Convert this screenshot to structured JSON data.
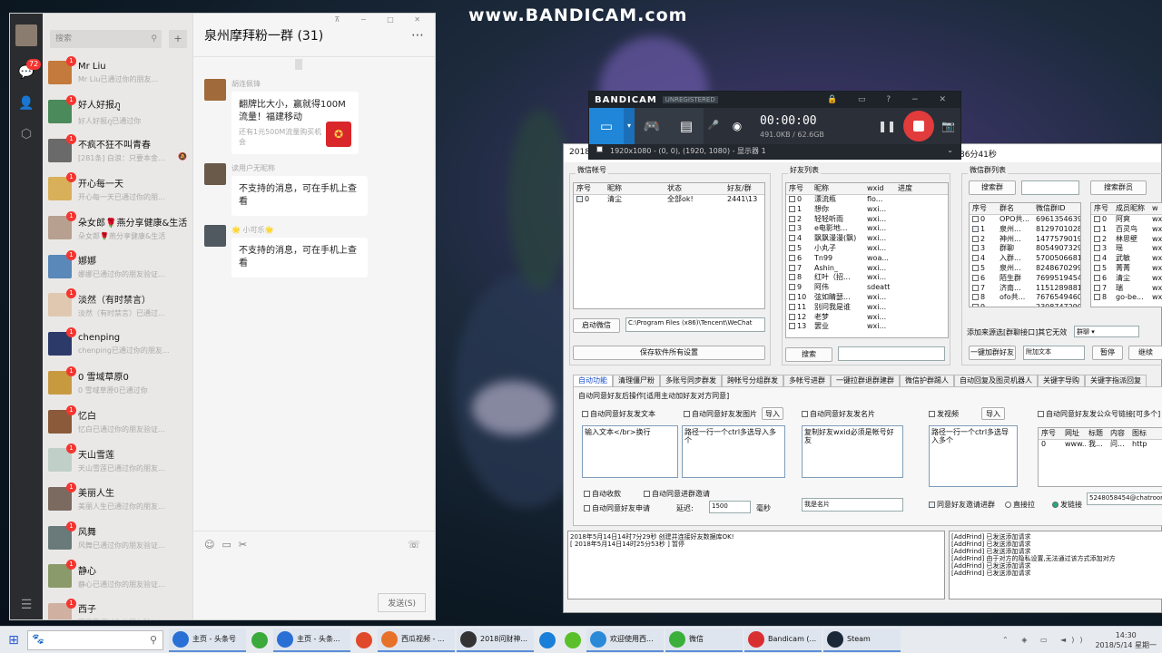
{
  "watermark": "www.BANDICAM.com",
  "wechat": {
    "nav_badge": "72",
    "search_placeholder": "搜索",
    "chat_title": "泉州摩拜粉一群 (31)",
    "contacts": [
      {
        "name": "Mr Liu",
        "preview": "Mr Liu已通过你的朋友...",
        "color": "#c47a3a"
      },
      {
        "name": "好人好报ภู",
        "preview": "好人好报ภู已通过你",
        "color": "#4b8a5a"
      },
      {
        "name": "不疯不狂不叫青春",
        "preview": "[281条] 白浪：只要本金...",
        "color": "#6a6a6a",
        "mute": true
      },
      {
        "name": "开心每一天",
        "preview": "开心每一天已通过你的朋...",
        "color": "#d8b05a"
      },
      {
        "name": "朵女郎🌹燕分享健康&生活",
        "preview": "朵女郎🌹燕分享健康&生活",
        "color": "#b7a090"
      },
      {
        "name": "娜娜",
        "preview": "娜娜已通过你的朋友验证...",
        "color": "#5a88b8"
      },
      {
        "name": "淡然（有时禁言）",
        "preview": "淡然（有时禁言）已通过...",
        "color": "#e0c8b0"
      },
      {
        "name": "chenping",
        "preview": "chenping已通过你的朋友...",
        "color": "#2c3a6a"
      },
      {
        "name": "0 雪域草原0",
        "preview": "0 雪域草原0已通过你",
        "color": "#c89a40"
      },
      {
        "name": "忆白",
        "preview": "忆白已通过你的朋友验证...",
        "color": "#8a5a3a"
      },
      {
        "name": "天山雪莲",
        "preview": "天山雪莲已通过你的朋友...",
        "color": "#c0d0c8"
      },
      {
        "name": "美丽人生",
        "preview": "美丽人生已通过你的朋友...",
        "color": "#7a6a60"
      },
      {
        "name": "风舞",
        "preview": "风舞已通过你的朋友验证...",
        "color": "#6a7a7a"
      },
      {
        "name": "静心",
        "preview": "静心已通过你的朋友验证...",
        "color": "#8a9a6a"
      },
      {
        "name": "西子",
        "preview": "西子已通过你的朋友验证...",
        "color": "#d0b0a0"
      }
    ],
    "messages": {
      "m1_sender": "胡连佩锋",
      "m1_title": "翻牌比大小，赢就得100M流量！福建移动",
      "m1_sub": "还有1元500M流量购买机会",
      "m2_sender": "读用户无昵称",
      "m2_text": "不支持的消息，可在手机上查看",
      "m3_sender": "🌟 小可乐🌟",
      "m3_text": "不支持的消息，可在手机上查看"
    },
    "send_label": "发送(S)"
  },
  "bandicam": {
    "logo": "BANDICAM",
    "unreg": "UNREGISTERED",
    "time": "00:00:00",
    "size": "491.0KB / 62.6GB",
    "info": "1920x1080 - (0, 0), (1920, 1080) - 显示器 1"
  },
  "tool": {
    "title_left": "2018",
    "title_right": "86分41秒",
    "wx_account_label": "微信帐号",
    "acc_headers": [
      "序号",
      "昵称",
      "状态",
      "好友/群"
    ],
    "acc_rows": [
      [
        "0",
        "清尘",
        "全部ok!",
        "2441\\13"
      ]
    ],
    "start_wechat_btn": "启动微信",
    "path_value": "C:\\Program Files (x86)\\Tencent\\WeChat",
    "save_btn": "保存软件所有设置",
    "friend_label": "好友列表",
    "friend_headers": [
      "序号",
      "昵称",
      "wxid",
      "进度"
    ],
    "friends": [
      [
        "0",
        "漂流瓶",
        "flo..."
      ],
      [
        "1",
        "想你",
        "wxi..."
      ],
      [
        "2",
        "轻轻听雨",
        "wxi..."
      ],
      [
        "3",
        "e电影地...",
        "wxi..."
      ],
      [
        "4",
        "飘飘漫漫(飘)",
        "wxi..."
      ],
      [
        "5",
        "小丸子",
        "wxi..."
      ],
      [
        "6",
        "Tn99",
        "woa..."
      ],
      [
        "7",
        "Ashin_",
        "wxi..."
      ],
      [
        "8",
        "红叶（招...",
        "wxi..."
      ],
      [
        "9",
        "阿伟",
        "sdeatt"
      ],
      [
        "10",
        "弦如睛瑟...",
        "wxi..."
      ],
      [
        "11",
        "别问我是谁",
        "wxi..."
      ],
      [
        "12",
        "老梦",
        "wxi..."
      ],
      [
        "13",
        "罢业",
        "wxi..."
      ]
    ],
    "search_btn": "搜索",
    "group_label": "微信群列表",
    "search_group_btn": "搜索群",
    "search_member_btn": "搜索群员",
    "group_headers": [
      "序号",
      "群名",
      "微信群ID"
    ],
    "groups": [
      [
        "0",
        "OPO共...",
        "6961354639"
      ],
      [
        "1",
        "泉州...",
        "8129701028"
      ],
      [
        "2",
        "神州...",
        "1477579019"
      ],
      [
        "3",
        "群聊",
        "8054907329"
      ],
      [
        "4",
        "入群...",
        "5700506681"
      ],
      [
        "5",
        "泉州...",
        "8248670299"
      ],
      [
        "6",
        "陌生群",
        "7699519454"
      ],
      [
        "7",
        "济南...",
        "1151289881"
      ],
      [
        "8",
        "ofo共...",
        "7676549460"
      ],
      [
        "9",
        "...",
        "2308747290"
      ]
    ],
    "member_headers": [
      "序号",
      "成员昵称",
      "w"
    ],
    "members": [
      [
        "0",
        "阿爽",
        "wx"
      ],
      [
        "1",
        "百灵鸟",
        "wx"
      ],
      [
        "2",
        "林思壁",
        "wx"
      ],
      [
        "3",
        "瑶",
        "wx"
      ],
      [
        "4",
        "武敏",
        "wx"
      ],
      [
        "5",
        "菁菁",
        "wx"
      ],
      [
        "6",
        "清尘",
        "wx"
      ],
      [
        "7",
        "瑞",
        "wx"
      ],
      [
        "8",
        "go-be...",
        "wx"
      ]
    ],
    "add_source_label": "添加来源选[群聊接口]其它无效",
    "add_source_value": "群聊",
    "one_key_btn": "一键加群好友",
    "attach_text": "附加文本",
    "pause_btn": "暂停",
    "continue_btn": "继续",
    "tabs": [
      "自动功能",
      "清理僵尸粉",
      "多账号同步群发",
      "跨帐号分组群发",
      "多帐号进群",
      "一键拉群退群建群",
      "微信护群踢人",
      "自动回复及图灵机器人",
      "关键字导购",
      "关键字指派回复"
    ],
    "auto_title": "自动同意好友后操作[适用主动加好友对方同意]",
    "opt_text": "自动同意好友发文本",
    "opt_image": "自动同意好友发图片",
    "import1": "导入",
    "opt_card": "自动同意好友发名片",
    "opt_video": "发视频",
    "import2": "导入",
    "opt_official": "自动同意好友发公众号链接[可多个]",
    "ta_text": "输入文本</br>换行",
    "ta_image": "路径一行一个ctrl多选导入多个",
    "ta_card": "复制好友wxid必须是帐号好友",
    "ta_video": "路径一行一个ctrl多选导入多个",
    "link_headers": [
      "序号",
      "网址",
      "标题",
      "内容",
      "图标"
    ],
    "link_rows": [
      [
        "0",
        "www...",
        "我...",
        "问...",
        "http"
      ]
    ],
    "opt_receipt": "自动收款",
    "opt_invite": "自动同意进群邀请",
    "opt_apply": "自动同意好友申请",
    "delay_label": "延迟:",
    "delay_value": "1500",
    "delay_unit": "毫秒",
    "card_name": "我是名片",
    "agree_invite": "同意好友邀请进群",
    "direct_pull": "直接拉",
    "send_link": "发链接",
    "chatroom": "5248058454@chatroom",
    "log_left": [
      "2018年5月14日14时7分29秒 创建并连接好友数据库OK!",
      "[ 2018年5月14日14时25分53秒 ] 暂停"
    ],
    "log_right": [
      "[AddFrind] 已发送添加请求",
      "[AddFrind] 已发送添加请求",
      "[AddFrind] 已发送添加请求",
      "[AddFrind] 由于对方的隐私设置,无法通过该方式添加对方",
      "[AddFrind] 已发送添加请求",
      "[AddFrind] 已发送添加请求"
    ]
  },
  "taskbar": {
    "items": [
      {
        "label": "主页 - 头条号",
        "color": "#2a6fd6"
      },
      {
        "label": "",
        "color": "#3aaa3a"
      },
      {
        "label": "主页 - 头条...",
        "color": "#2a6fd6"
      },
      {
        "label": "",
        "color": "#e04a2a"
      },
      {
        "label": "西瓜视频 - ...",
        "color": "#e8712a"
      },
      {
        "label": "2018问财神...",
        "color": "#333"
      },
      {
        "label": "",
        "color": "#1a7fd8"
      },
      {
        "label": "",
        "color": "#5ac02a"
      },
      {
        "label": "欢迎使用西...",
        "color": "#2a8ad8"
      },
      {
        "label": "微信",
        "color": "#3ab03a"
      },
      {
        "label": "Bandicam (...",
        "color": "#d83030"
      },
      {
        "label": "Steam",
        "color": "#1b2838"
      }
    ],
    "time": "14:30",
    "date": "2018/5/14 星期一"
  }
}
